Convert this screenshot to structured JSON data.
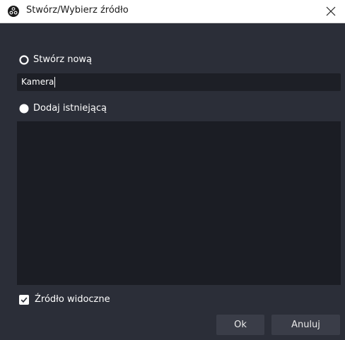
{
  "window": {
    "title": "Stwórz/Wybierz źródło",
    "app_icon": "obs-logo-icon",
    "close_icon": "close-icon"
  },
  "create_new": {
    "label": "Stwórz nową",
    "selected": true,
    "input_value": "Kamera"
  },
  "add_existing": {
    "label": "Dodaj istniejącą",
    "selected": false,
    "items": []
  },
  "visible_checkbox": {
    "label": "Źródło widoczne",
    "checked": true
  },
  "buttons": {
    "ok": "Ok",
    "cancel": "Anuluj"
  },
  "colors": {
    "background": "#2b2e38",
    "input_bg": "#1d1f26",
    "list_bg": "#1b1d24",
    "button_bg": "#3a3d48"
  }
}
